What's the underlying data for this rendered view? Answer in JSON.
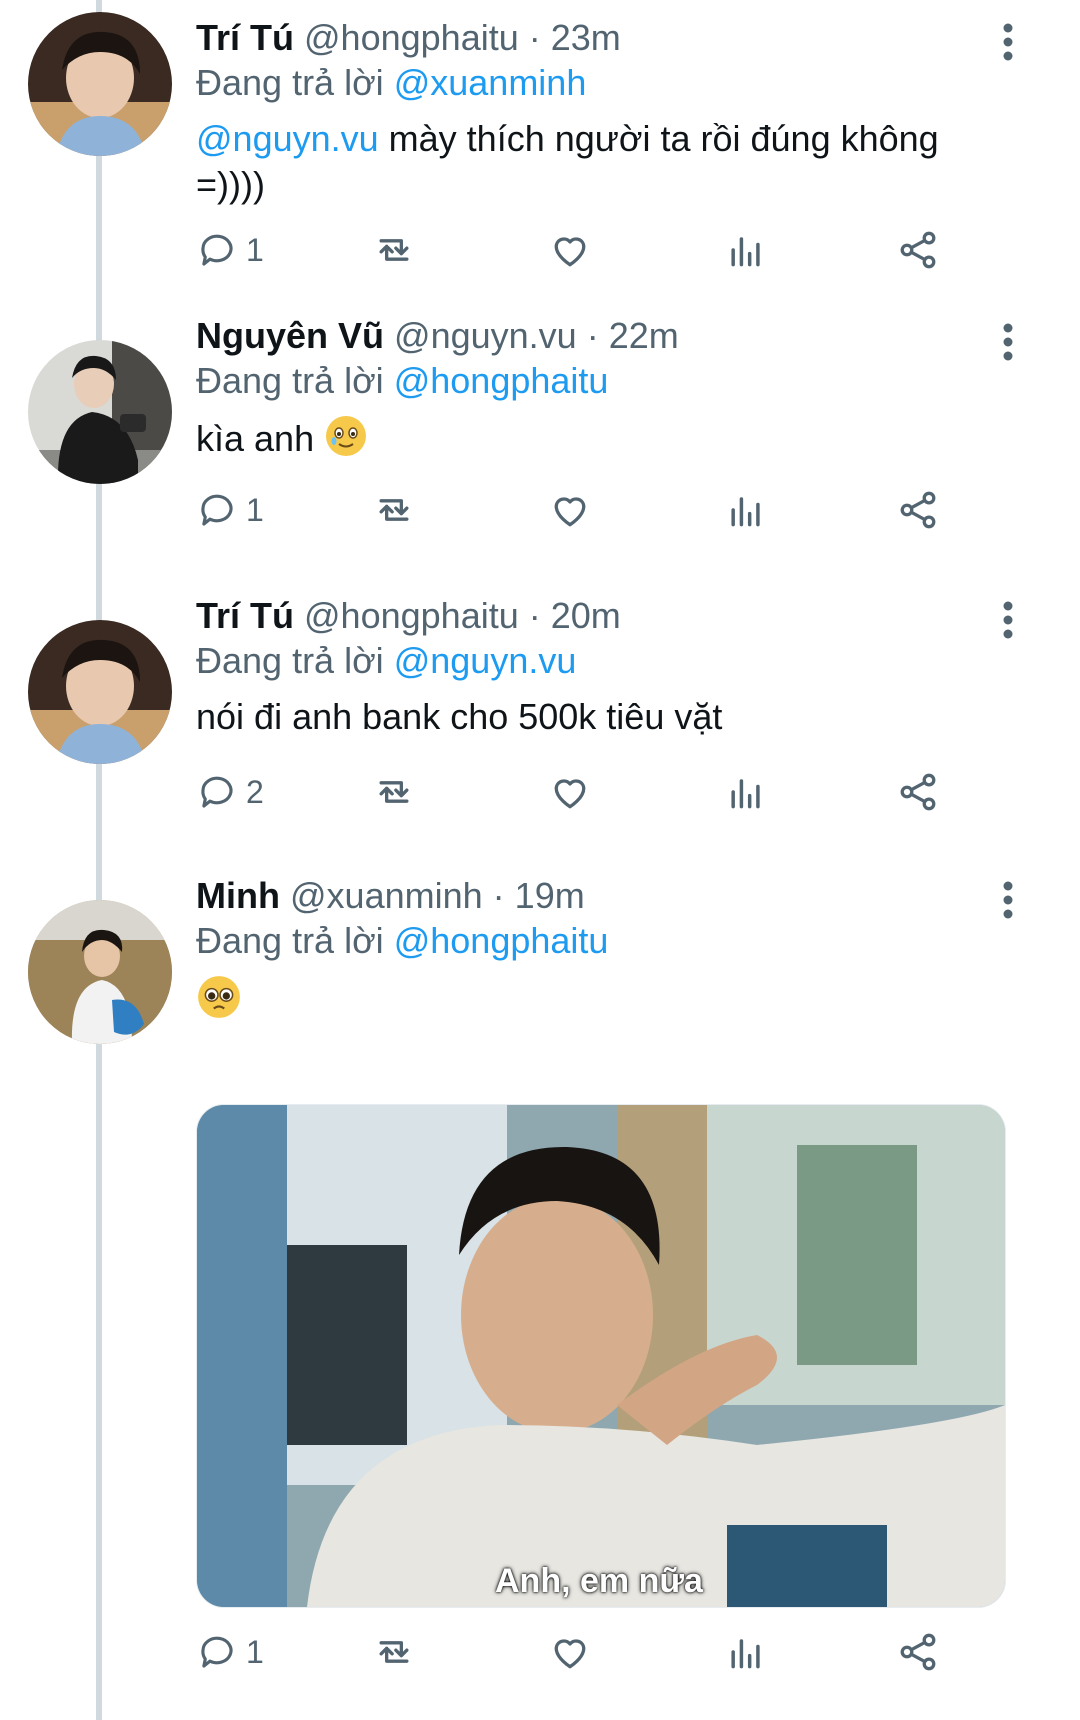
{
  "reply_prefix": "Đang trả lời",
  "tweets": [
    {
      "name": "Trí Tú",
      "handle": "@hongphaitu",
      "sep": "·",
      "time": "23m",
      "reply_to": "@xuanminh",
      "mention": "@nguyn.vu",
      "text": " mày thích người ta rồi đúng không =))))",
      "reply_count": "1"
    },
    {
      "name": "Nguyên Vũ",
      "handle": "@nguyn.vu",
      "sep": "·",
      "time": "22m",
      "reply_to": "@hongphaitu",
      "text": "kìa anh",
      "emoji": "smiling-face-with-tear",
      "reply_count": "1"
    },
    {
      "name": "Trí Tú",
      "handle": "@hongphaitu",
      "sep": "·",
      "time": "20m",
      "reply_to": "@nguyn.vu",
      "text": "nói đi anh bank cho 500k tiêu vặt",
      "reply_count": "2"
    },
    {
      "name": "Minh",
      "handle": "@xuanminh",
      "sep": "·",
      "time": "19m",
      "reply_to": "@hongphaitu",
      "emoji": "pleading-face",
      "media_caption": "Anh, em nữa",
      "reply_count": "1"
    }
  ],
  "colors": {
    "link": "#1d9bf0",
    "secondary": "#536471",
    "thread_line": "#cfd9de"
  },
  "icons": [
    "reply-icon",
    "retweet-icon",
    "like-icon",
    "views-icon",
    "share-icon",
    "more-icon"
  ]
}
